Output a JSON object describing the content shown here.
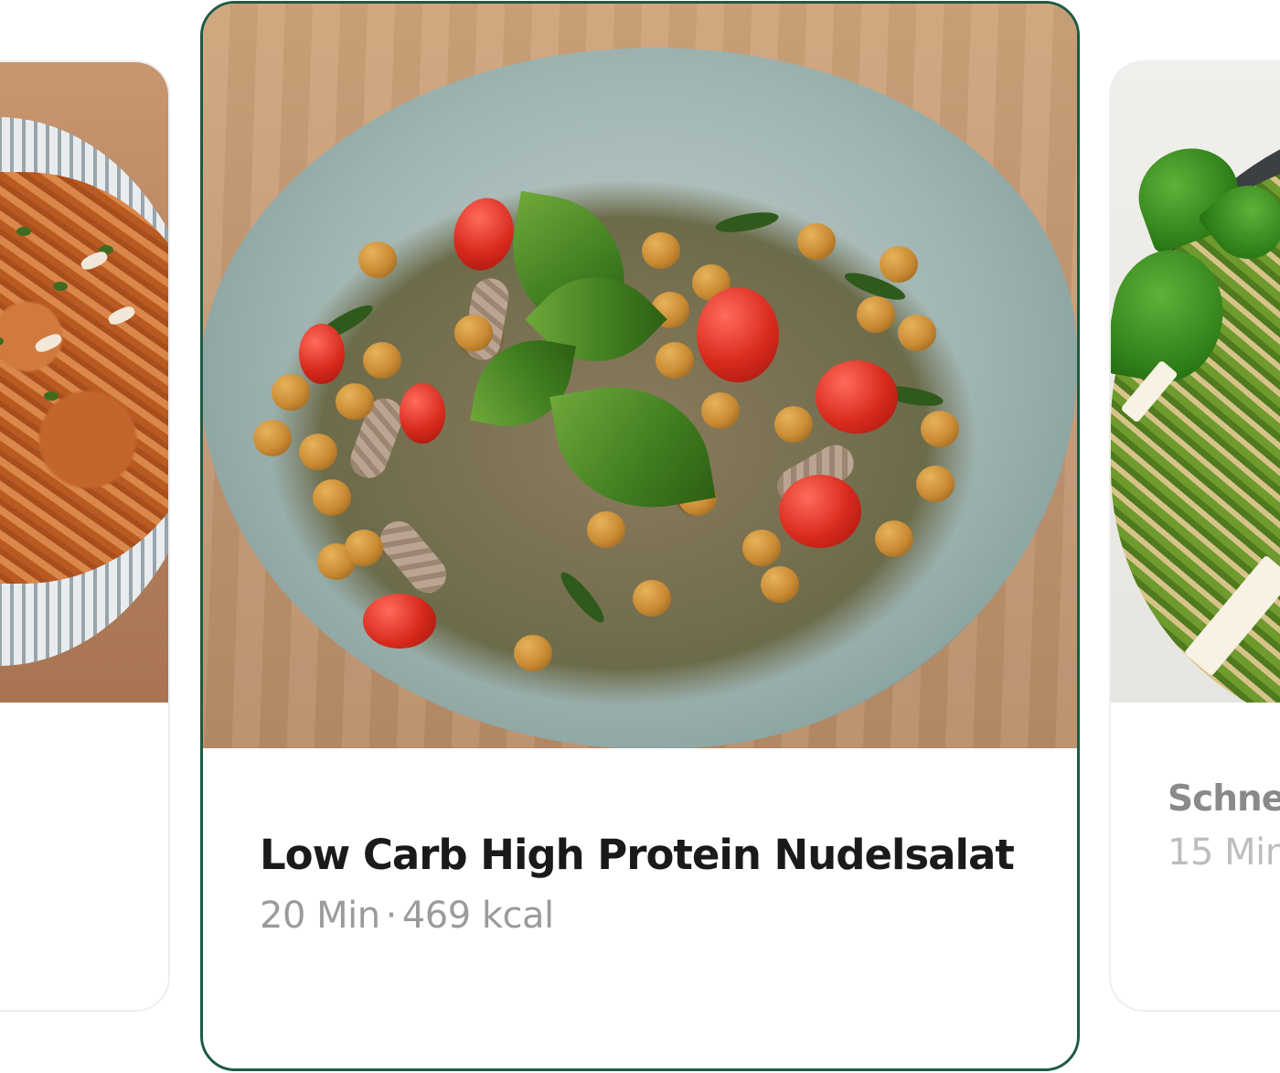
{
  "recipes": [
    {
      "title": "",
      "time": "",
      "calories": "",
      "photo": "tomato-fusilli-in-striped-bowl"
    },
    {
      "title": "Low Carb High Protein Nudelsalat",
      "time": "20 Min",
      "calories": "469 kcal",
      "photo": "chickpea-pasta-salad-with-basil"
    },
    {
      "title": "Schne Protei",
      "time": "15 Min",
      "calories": "",
      "photo": "green-pesto-pasta-with-basil"
    }
  ],
  "separator": "·",
  "colors": {
    "active_border": "#1f5a42",
    "title_active": "#1a1a1a",
    "title_inactive": "#8a8a8a",
    "meta": "#9b9b9b"
  }
}
